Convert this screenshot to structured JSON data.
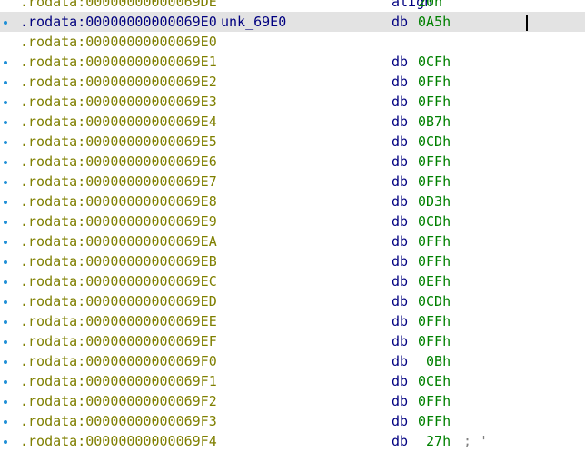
{
  "listing": {
    "rows": [
      {
        "address": ".rodata:00000000000069DE",
        "label": "",
        "mnemonic": "align",
        "operand": "20h",
        "comment": "",
        "dot": false,
        "selected": false
      },
      {
        "address": ".rodata:00000000000069E0",
        "label": "unk_69E0",
        "mnemonic": "db",
        "operand": "0A5h",
        "comment": "",
        "dot": true,
        "selected": true
      },
      {
        "address": ".rodata:00000000000069E0",
        "label": "",
        "mnemonic": "",
        "operand": "",
        "comment": "",
        "dot": false,
        "selected": false
      },
      {
        "address": ".rodata:00000000000069E1",
        "label": "",
        "mnemonic": "db",
        "operand": "0CFh",
        "comment": "",
        "dot": true,
        "selected": false
      },
      {
        "address": ".rodata:00000000000069E2",
        "label": "",
        "mnemonic": "db",
        "operand": "0FFh",
        "comment": "",
        "dot": true,
        "selected": false
      },
      {
        "address": ".rodata:00000000000069E3",
        "label": "",
        "mnemonic": "db",
        "operand": "0FFh",
        "comment": "",
        "dot": true,
        "selected": false
      },
      {
        "address": ".rodata:00000000000069E4",
        "label": "",
        "mnemonic": "db",
        "operand": "0B7h",
        "comment": "",
        "dot": true,
        "selected": false
      },
      {
        "address": ".rodata:00000000000069E5",
        "label": "",
        "mnemonic": "db",
        "operand": "0CDh",
        "comment": "",
        "dot": true,
        "selected": false
      },
      {
        "address": ".rodata:00000000000069E6",
        "label": "",
        "mnemonic": "db",
        "operand": "0FFh",
        "comment": "",
        "dot": true,
        "selected": false
      },
      {
        "address": ".rodata:00000000000069E7",
        "label": "",
        "mnemonic": "db",
        "operand": "0FFh",
        "comment": "",
        "dot": true,
        "selected": false
      },
      {
        "address": ".rodata:00000000000069E8",
        "label": "",
        "mnemonic": "db",
        "operand": "0D3h",
        "comment": "",
        "dot": true,
        "selected": false
      },
      {
        "address": ".rodata:00000000000069E9",
        "label": "",
        "mnemonic": "db",
        "operand": "0CDh",
        "comment": "",
        "dot": true,
        "selected": false
      },
      {
        "address": ".rodata:00000000000069EA",
        "label": "",
        "mnemonic": "db",
        "operand": "0FFh",
        "comment": "",
        "dot": true,
        "selected": false
      },
      {
        "address": ".rodata:00000000000069EB",
        "label": "",
        "mnemonic": "db",
        "operand": "0FFh",
        "comment": "",
        "dot": true,
        "selected": false
      },
      {
        "address": ".rodata:00000000000069EC",
        "label": "",
        "mnemonic": "db",
        "operand": "0EFh",
        "comment": "",
        "dot": true,
        "selected": false
      },
      {
        "address": ".rodata:00000000000069ED",
        "label": "",
        "mnemonic": "db",
        "operand": "0CDh",
        "comment": "",
        "dot": true,
        "selected": false
      },
      {
        "address": ".rodata:00000000000069EE",
        "label": "",
        "mnemonic": "db",
        "operand": "0FFh",
        "comment": "",
        "dot": true,
        "selected": false
      },
      {
        "address": ".rodata:00000000000069EF",
        "label": "",
        "mnemonic": "db",
        "operand": "0FFh",
        "comment": "",
        "dot": true,
        "selected": false
      },
      {
        "address": ".rodata:00000000000069F0",
        "label": "",
        "mnemonic": "db",
        "operand": " 0Bh",
        "comment": "",
        "dot": true,
        "selected": false
      },
      {
        "address": ".rodata:00000000000069F1",
        "label": "",
        "mnemonic": "db",
        "operand": "0CEh",
        "comment": "",
        "dot": true,
        "selected": false
      },
      {
        "address": ".rodata:00000000000069F2",
        "label": "",
        "mnemonic": "db",
        "operand": "0FFh",
        "comment": "",
        "dot": true,
        "selected": false
      },
      {
        "address": ".rodata:00000000000069F3",
        "label": "",
        "mnemonic": "db",
        "operand": "0FFh",
        "comment": "",
        "dot": true,
        "selected": false
      },
      {
        "address": ".rodata:00000000000069F4",
        "label": "",
        "mnemonic": "db",
        "operand": " 27h",
        "comment": "; '",
        "dot": true,
        "selected": false
      }
    ]
  },
  "colors": {
    "address": "#7f7f00",
    "selected_address": "#000080",
    "mnemonic": "#000080",
    "operand": "#008000",
    "dot": "#1e8fd6",
    "selection": "#e3e3e3",
    "gutter_line": "#7fb0c8"
  },
  "icons": {
    "row_marker": "breakpoint-dot-icon",
    "caret": "text-caret"
  }
}
